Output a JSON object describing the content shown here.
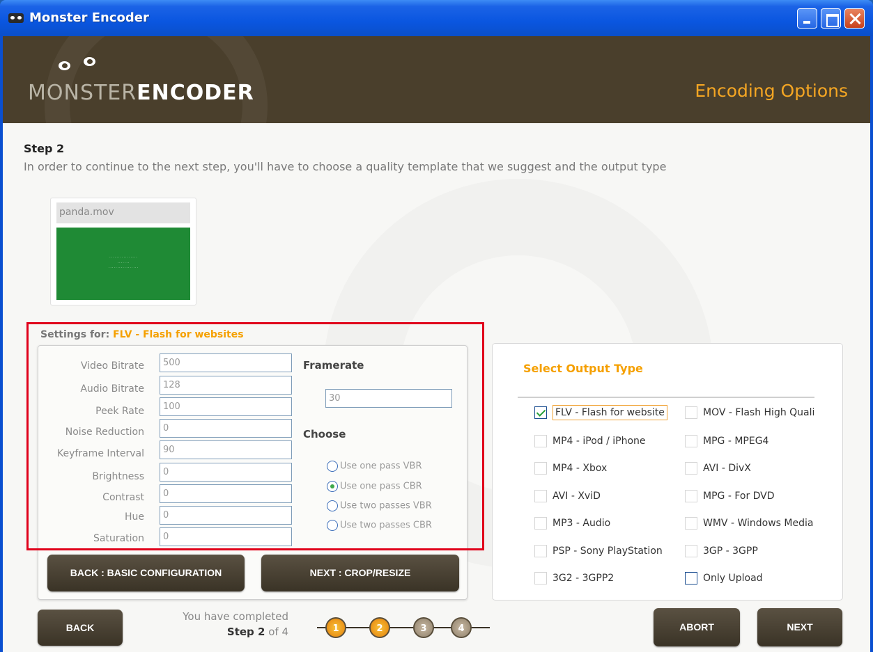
{
  "window": {
    "title": "Monster Encoder"
  },
  "banner": {
    "logo_light": "MONSTER",
    "logo_bold": "ENCODER",
    "section": "Encoding Options"
  },
  "step": {
    "title": "Step 2",
    "description": "In order to continue to the next step, you'll have to choose a quality template that we suggest and the output type"
  },
  "file": {
    "name": "panda.mov"
  },
  "settings": {
    "label": "Settings for:",
    "profile": "FLV - Flash for websites",
    "fields": [
      {
        "label": "Video Bitrate",
        "value": "500"
      },
      {
        "label": "Audio Bitrate",
        "value": "128"
      },
      {
        "label": "Peek Rate",
        "value": "100"
      },
      {
        "label": "Noise Reduction",
        "value": "0"
      },
      {
        "label": "Keyframe Interval",
        "value": "90"
      },
      {
        "label": "Brightness",
        "value": "0"
      },
      {
        "label": "Contrast",
        "value": "0"
      },
      {
        "label": "Hue",
        "value": "0"
      },
      {
        "label": "Saturation",
        "value": "0"
      }
    ],
    "framerate_label": "Framerate",
    "framerate_value": "30",
    "choose_label": "Choose",
    "pass_options": [
      {
        "label": "Use one pass VBR",
        "checked": false
      },
      {
        "label": "Use one pass CBR",
        "checked": true
      },
      {
        "label": "Use two passes VBR",
        "checked": false
      },
      {
        "label": "Use two passes CBR",
        "checked": false
      }
    ],
    "back_button": "BACK : BASIC CONFIGURATION",
    "next_button": "NEXT : CROP/RESIZE"
  },
  "output": {
    "title": "Select Output Type",
    "options_left": [
      {
        "label": "FLV - Flash for website",
        "checked": true
      },
      {
        "label": "MP4 - iPod / iPhone",
        "checked": false
      },
      {
        "label": "MP4 - Xbox",
        "checked": false
      },
      {
        "label": "AVI - XviD",
        "checked": false
      },
      {
        "label": "MP3 - Audio",
        "checked": false
      },
      {
        "label": "PSP - Sony PlayStation",
        "checked": false
      },
      {
        "label": "3G2 - 3GPP2",
        "checked": false
      }
    ],
    "options_right": [
      {
        "label": "MOV - Flash High Quali",
        "checked": false
      },
      {
        "label": "MPG - MPEG4",
        "checked": false
      },
      {
        "label": "AVI - DivX",
        "checked": false
      },
      {
        "label": "MPG - For DVD",
        "checked": false
      },
      {
        "label": "WMV - Windows Media",
        "checked": false
      },
      {
        "label": "3GP - 3GPP",
        "checked": false
      },
      {
        "label": "Only Upload",
        "checked": false
      }
    ]
  },
  "footer": {
    "back": "BACK",
    "completed_line1": "You have completed",
    "completed_step": "Step 2",
    "completed_of": "of 4",
    "steps": [
      "1",
      "2",
      "3",
      "4"
    ],
    "current_step": 2,
    "abort": "ABORT",
    "next": "NEXT"
  },
  "colors": {
    "accent": "#f5a000",
    "banner": "#4a3f2c",
    "highlight": "#e0001a"
  }
}
